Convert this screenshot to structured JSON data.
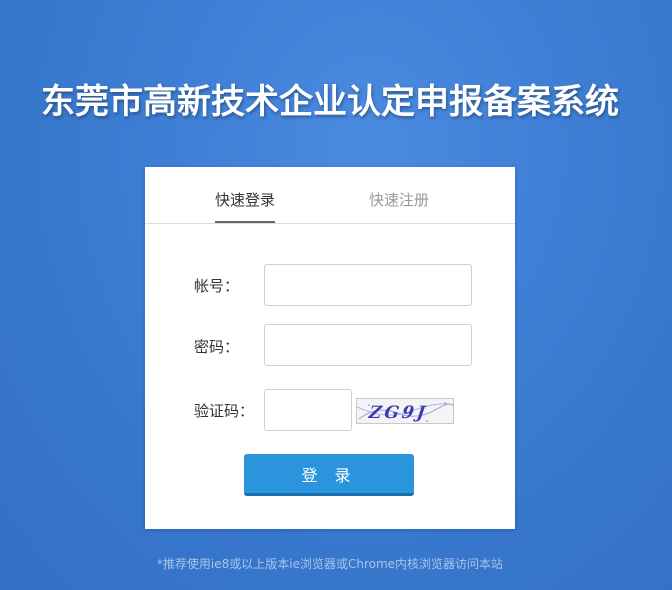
{
  "page_title": "东莞市高新技术企业认定申报备案系统",
  "tabs": {
    "login": "快速登录",
    "register": "快速注册"
  },
  "form": {
    "account_label": "帐号：",
    "account_value": "",
    "password_label": "密码：",
    "password_value": "",
    "captcha_label": "验证码：",
    "captcha_value": "",
    "captcha_image_text": "ZG9J",
    "login_button": "登 录"
  },
  "footer_note": "*推荐使用ie8或以上版本ie浏览器或Chrome内核浏览器访问本站",
  "colors": {
    "background": "#3f80d6",
    "button": "#2a95dc",
    "captcha_text": "#3a3ab0"
  }
}
